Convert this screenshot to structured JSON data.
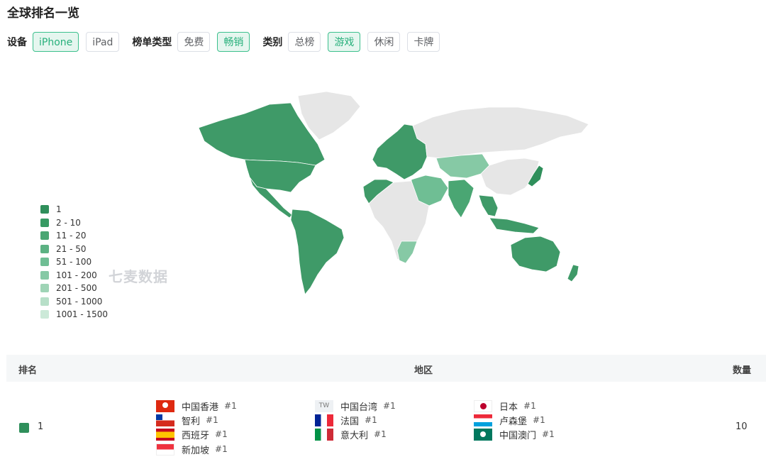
{
  "title": "全球排名一览",
  "filters": {
    "device": {
      "label": "设备",
      "options": [
        "iPhone",
        "iPad"
      ],
      "active": "iPhone"
    },
    "chart_type": {
      "label": "榜单类型",
      "options": [
        "免费",
        "畅销"
      ],
      "active": "畅销"
    },
    "category": {
      "label": "类别",
      "options": [
        "总榜",
        "游戏",
        "休闲",
        "卡牌"
      ],
      "active": "游戏"
    }
  },
  "legend": [
    {
      "label": "1",
      "color": "#2f8f5b"
    },
    {
      "label": "2 - 10",
      "color": "#379a63"
    },
    {
      "label": "11 - 20",
      "color": "#4aa673"
    },
    {
      "label": "21 - 50",
      "color": "#5cb283"
    },
    {
      "label": "51 - 100",
      "color": "#6fbe94"
    },
    {
      "label": "101 - 200",
      "color": "#86c9a5"
    },
    {
      "label": "201 - 500",
      "color": "#9fd4b6"
    },
    {
      "label": "501 - 1000",
      "color": "#b7dfc8"
    },
    {
      "label": "1001 - 1500",
      "color": "#cce9d8"
    }
  ],
  "watermark": "七麦数据",
  "table": {
    "headers": {
      "rank": "排名",
      "region": "地区",
      "count": "数量"
    },
    "rows": [
      {
        "rank": "1",
        "count": "10",
        "regions": [
          {
            "name": "中国香港",
            "rank": "#1",
            "flag": "hk-flag"
          },
          {
            "name": "中国台湾",
            "rank": "#1",
            "flag": "tw-flag",
            "flag_text": "TW"
          },
          {
            "name": "日本",
            "rank": "#1",
            "flag": "jp-flag"
          },
          {
            "name": "智利",
            "rank": "#1",
            "flag": "cl-flag"
          },
          {
            "name": "法国",
            "rank": "#1",
            "flag": "fr-flag"
          },
          {
            "name": "卢森堡",
            "rank": "#1",
            "flag": "lu-flag"
          },
          {
            "name": "西班牙",
            "rank": "#1",
            "flag": "es-flag"
          },
          {
            "name": "意大利",
            "rank": "#1",
            "flag": "it-flag"
          },
          {
            "name": "中国澳门",
            "rank": "#1",
            "flag": "mo-flag"
          },
          {
            "name": "新加坡",
            "rank": "#1",
            "flag": "sg-flag"
          }
        ]
      }
    ]
  }
}
